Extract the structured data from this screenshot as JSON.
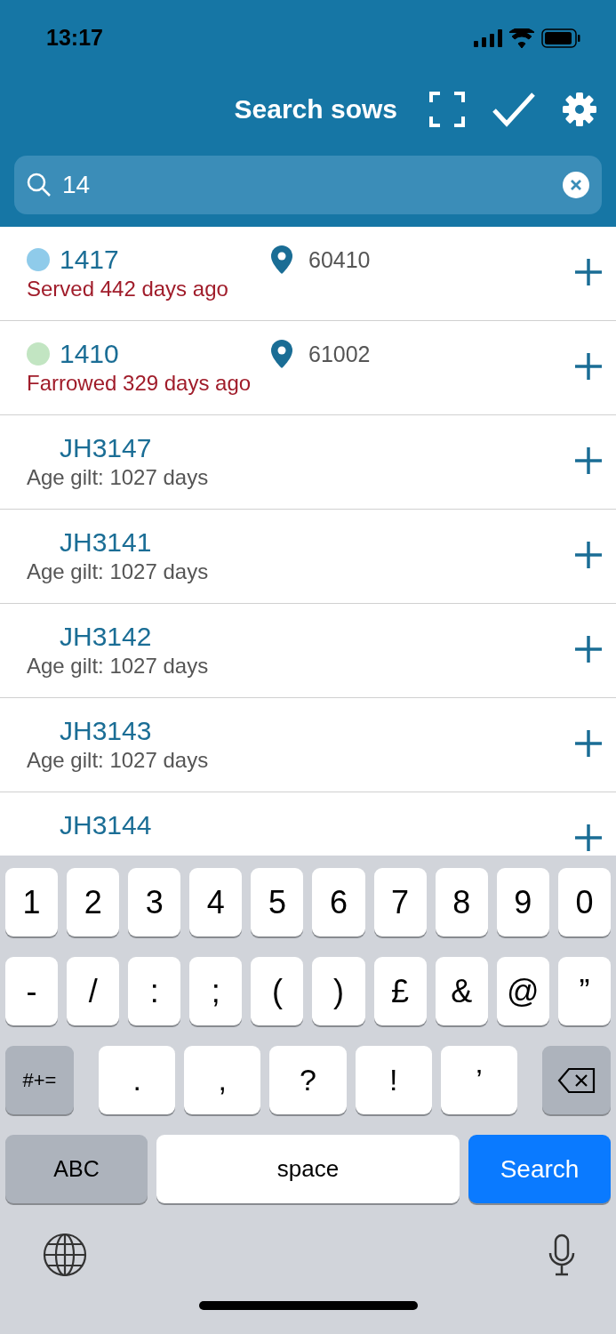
{
  "status_bar": {
    "time": "13:17"
  },
  "header": {
    "title": "Search sows"
  },
  "search": {
    "value": "14"
  },
  "results": [
    {
      "id": "1417",
      "color": "#8fcbea",
      "location": "60410",
      "status": "Served 442 days ago",
      "alert": true
    },
    {
      "id": "1410",
      "color": "#c2e5c2",
      "location": "61002",
      "status": "Farrowed 329 days ago",
      "alert": true
    },
    {
      "id": "JH3147",
      "status": "Age gilt: 1027 days",
      "alert": false
    },
    {
      "id": "JH3141",
      "status": "Age gilt: 1027 days",
      "alert": false
    },
    {
      "id": "JH3142",
      "status": "Age gilt: 1027 days",
      "alert": false
    },
    {
      "id": "JH3143",
      "status": "Age gilt: 1027 days",
      "alert": false
    },
    {
      "id": "JH3144"
    }
  ],
  "keyboard": {
    "digit_keys": [
      {
        "label": "1"
      },
      {
        "label": "2"
      },
      {
        "label": "3"
      },
      {
        "label": "4"
      },
      {
        "label": "5"
      },
      {
        "label": "6"
      },
      {
        "label": "7"
      },
      {
        "label": "8"
      },
      {
        "label": "9"
      },
      {
        "label": "0"
      }
    ],
    "symbol_keys": [
      {
        "label": "-"
      },
      {
        "label": "/"
      },
      {
        "label": ":"
      },
      {
        "label": ";"
      },
      {
        "label": "("
      },
      {
        "label": ")"
      },
      {
        "label": "£"
      },
      {
        "label": "&"
      },
      {
        "label": "@"
      },
      {
        "label": "”"
      }
    ],
    "punctuation_keys": [
      {
        "label": "#+=",
        "kind": "mode"
      },
      {
        "label": ".",
        "kind": "wide"
      },
      {
        "label": ",",
        "kind": "wide"
      },
      {
        "label": "?",
        "kind": "wide"
      },
      {
        "label": "!",
        "kind": "wide"
      },
      {
        "label": "’",
        "kind": "wide"
      },
      {
        "kind": "delete"
      }
    ],
    "bottom_keys": [
      {
        "label": "ABC",
        "kind": "abc"
      },
      {
        "label": "space",
        "kind": "space"
      },
      {
        "label": "Search",
        "kind": "action"
      }
    ]
  }
}
